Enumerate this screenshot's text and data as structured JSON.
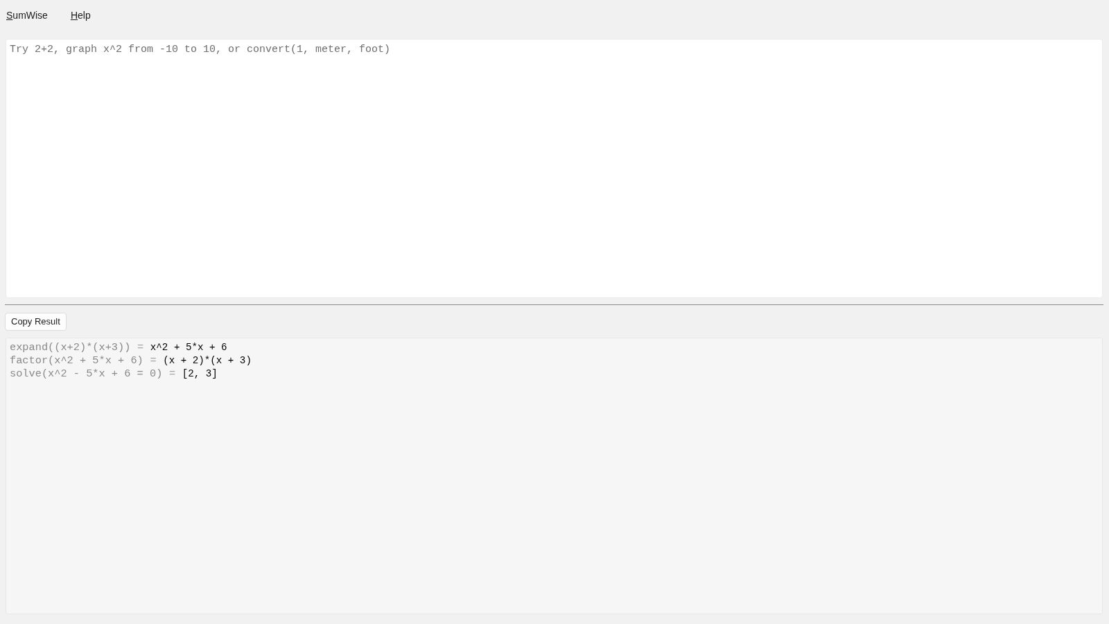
{
  "menu": [
    {
      "label": "SumWise"
    },
    {
      "label": "Help"
    }
  ],
  "editor": {
    "placeholder": "Try 2+2, graph x^2 from -10 to 10, or convert(1, meter, foot)"
  },
  "copy_button": {
    "label": "Copy Result"
  },
  "results": [
    {
      "expression": "expand((x+2)*(x+3))",
      "operator": "=",
      "result": "x^2 + 5*x + 6"
    },
    {
      "expression": "factor(x^2 + 5*x + 6)",
      "operator": "=",
      "result": "(x + 2)*(x + 3)"
    },
    {
      "expression": "solve(x^2 - 5*x + 6 = 0)",
      "operator": "=",
      "result": "[2, 3]"
    }
  ]
}
